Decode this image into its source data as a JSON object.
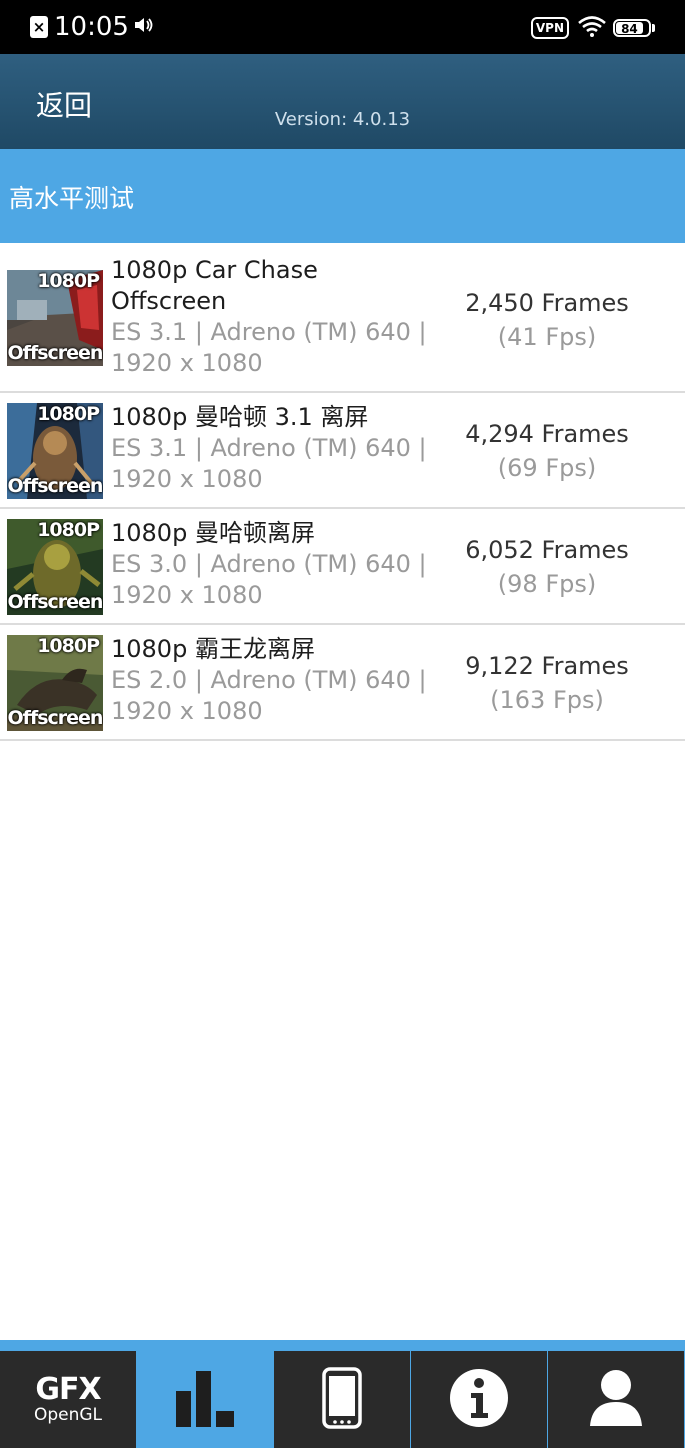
{
  "status_bar": {
    "time": "10:05",
    "vpn_label": "VPN",
    "battery_level": "84",
    "battery_fraction": 0.84
  },
  "header": {
    "back_label": "返回",
    "version": "Version: 4.0.13"
  },
  "section": {
    "title": "高水平测试"
  },
  "tests": [
    {
      "title_line1": "1080p Car Chase",
      "title_line2": "Offscreen",
      "spec_line1": "ES 3.1 | Adreno (TM) 640 |",
      "spec_line2": "1920 x 1080",
      "frames": "2,450 Frames",
      "fps": "(41 Fps)",
      "thumb_top": "1080P",
      "thumb_bottom": "Offscreen"
    },
    {
      "title_line1": "1080p 曼哈顿 3.1 离屏",
      "spec_line1": "ES 3.1 | Adreno (TM) 640 |",
      "spec_line2": "1920 x 1080",
      "frames": "4,294 Frames",
      "fps": "(69 Fps)",
      "thumb_top": "1080P",
      "thumb_bottom": "Offscreen"
    },
    {
      "title_line1": "1080p 曼哈顿离屏",
      "spec_line1": "ES 3.0 | Adreno (TM) 640 |",
      "spec_line2": "1920 x 1080",
      "frames": "6,052 Frames",
      "fps": "(98 Fps)",
      "thumb_top": "1080P",
      "thumb_bottom": "Offscreen"
    },
    {
      "title_line1": "1080p 霸王龙离屏",
      "spec_line1": "ES 2.0 | Adreno (TM) 640 |",
      "spec_line2": "1920 x 1080",
      "frames": "9,122 Frames",
      "fps": "(163 Fps)",
      "thumb_top": "1080P",
      "thumb_bottom": "Offscreen"
    }
  ],
  "bottom_nav": {
    "gfx_label": "GFX",
    "gfx_sublabel": "OpenGL",
    "active_tab": "results"
  },
  "colors": {
    "header": "#2a5676",
    "accent": "#4ea7e4",
    "nav_dark": "#2a2a2a"
  }
}
